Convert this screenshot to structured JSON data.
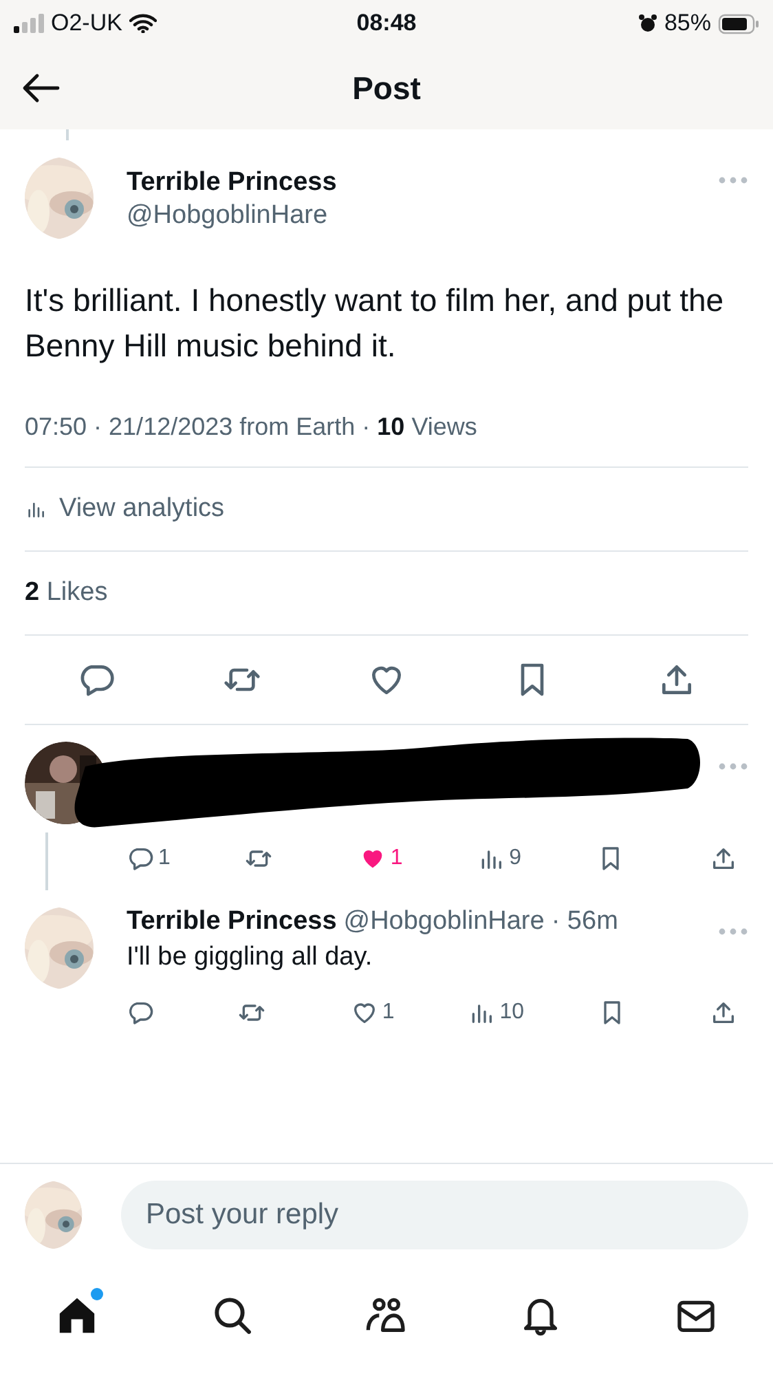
{
  "status_bar": {
    "carrier": "O2-UK",
    "time": "08:48",
    "battery": "85%",
    "alarm": true
  },
  "header": {
    "title": "Post"
  },
  "post": {
    "name": "Terrible Princess",
    "handle": "@HobgoblinHare",
    "text": "It's brilliant. I honestly want to film her, and put the Benny Hill music behind it.",
    "meta": "07:50 · 21/12/2023 from Earth · **10** Views",
    "analytics": "View analytics",
    "likes_count": "2",
    "likes_label": "Likes",
    "actions": [
      {
        "kind": "reply"
      },
      {
        "kind": "repost"
      },
      {
        "kind": "like",
        "liked": false
      },
      {
        "kind": "bookmark"
      },
      {
        "kind": "share"
      }
    ]
  },
  "replies": [
    {
      "redacted": true,
      "actions": [
        {
          "kind": "reply",
          "count": "1"
        },
        {
          "kind": "repost"
        },
        {
          "kind": "like",
          "liked": true,
          "count": "1"
        },
        {
          "kind": "views",
          "count": "9"
        },
        {
          "kind": "bookmark"
        },
        {
          "kind": "share"
        }
      ]
    },
    {
      "redacted": false,
      "name": "Terrible Princess",
      "handle": "@HobgoblinHare",
      "time": "· 56m",
      "text": "I'll be giggling all day.",
      "actions": [
        {
          "kind": "reply"
        },
        {
          "kind": "repost"
        },
        {
          "kind": "like",
          "liked": false,
          "count": "1"
        },
        {
          "kind": "views",
          "count": "10"
        },
        {
          "kind": "bookmark"
        },
        {
          "kind": "share"
        }
      ]
    }
  ],
  "composer": {
    "placeholder": "Post your reply"
  },
  "tab_bar": [
    {
      "kind": "home",
      "selected": true,
      "badge": true
    },
    {
      "kind": "search",
      "selected": false
    },
    {
      "kind": "communities",
      "selected": false
    },
    {
      "kind": "notifications",
      "selected": false
    },
    {
      "kind": "messages",
      "selected": false
    }
  ]
}
